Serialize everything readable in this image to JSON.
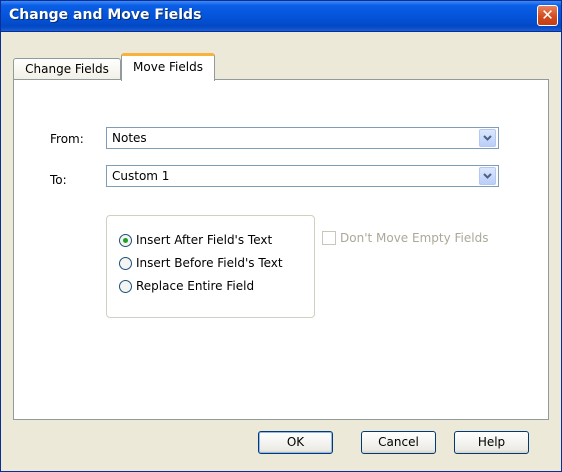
{
  "window": {
    "title": "Change and Move Fields",
    "close_glyph": "✕"
  },
  "tabs": [
    {
      "label": "Change Fields",
      "active": false
    },
    {
      "label": "Move Fields",
      "active": true
    }
  ],
  "form": {
    "from": {
      "label": "From:",
      "value": "Notes"
    },
    "to": {
      "label": "To:",
      "value": "Custom 1"
    },
    "options": [
      {
        "label": "Insert After Field's Text",
        "checked": true
      },
      {
        "label": "Insert Before Field's Text",
        "checked": false
      },
      {
        "label": "Replace Entire Field",
        "checked": false
      }
    ],
    "dont_move_empty": {
      "label": "Don't Move Empty Fields",
      "checked": false,
      "enabled": false
    }
  },
  "buttons": {
    "ok": "OK",
    "cancel": "Cancel",
    "help": "Help"
  },
  "colors": {
    "titlebar": "#0453d8",
    "tab_highlight": "#f7b33b",
    "radio_dot": "#21a121"
  }
}
